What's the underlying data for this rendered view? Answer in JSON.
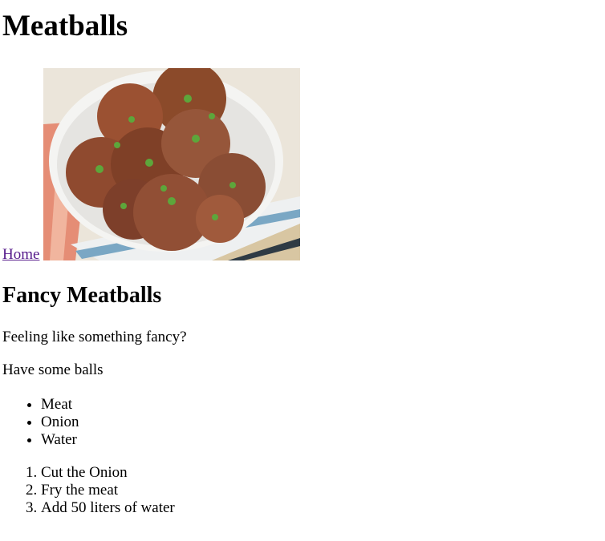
{
  "page": {
    "title": "Meatballs",
    "home_link": "Home",
    "image_alt": "meatballs",
    "subtitle": "Fancy Meatballs",
    "paragraphs": [
      "Feeling like something fancy?",
      "Have some balls"
    ],
    "ingredients": [
      "Meat",
      "Onion",
      "Water"
    ],
    "steps": [
      "Cut the Onion",
      "Fry the meat",
      "Add 50 liters of water"
    ]
  },
  "colors": {
    "link_visited": "#551a8b",
    "text": "#000000",
    "background": "#ffffff"
  }
}
